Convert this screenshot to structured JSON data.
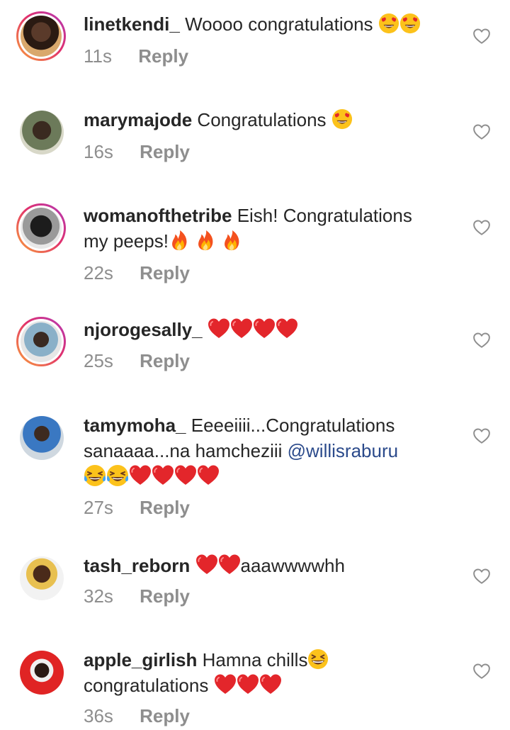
{
  "comments": [
    {
      "username": "linetkendi_",
      "text": "Woooo congratulations",
      "emoji": [
        "heart-eyes",
        "heart-eyes"
      ],
      "time": "11s",
      "reply": "Reply",
      "ring": true
    },
    {
      "username": "marymajode",
      "text": "Congratulations",
      "emoji": [
        "heart-eyes"
      ],
      "time": "16s",
      "reply": "Reply",
      "ring": false
    },
    {
      "username": "womanofthetribe",
      "text": "Eish! Congratulations",
      "text2": "my peeps!",
      "emoji": [
        "fire",
        "fire",
        "fire"
      ],
      "time": "22s",
      "reply": "Reply",
      "ring": true
    },
    {
      "username": "njorogesally_",
      "text": "",
      "emoji": [
        "red-heart",
        "red-heart",
        "red-heart",
        "red-heart"
      ],
      "time": "25s",
      "reply": "Reply",
      "ring": true
    },
    {
      "username": "tamymoha_",
      "text": "Eeeeiiii...Congratulations",
      "text2": "sanaaaa...na hamcheziii",
      "mention": "@willisraburu",
      "emoji": [
        "laughing-tears",
        "laughing-tears",
        "red-heart",
        "red-heart",
        "red-heart",
        "red-heart"
      ],
      "time": "27s",
      "reply": "Reply",
      "ring": false
    },
    {
      "username": "tash_reborn",
      "text_after": "aaawwwwhh",
      "emoji": [
        "red-heart",
        "red-heart"
      ],
      "time": "32s",
      "reply": "Reply",
      "ring": false
    },
    {
      "username": "apple_girlish",
      "text": "Hamna chills",
      "text2": "congratulations",
      "emoji": [
        "grinning-squint"
      ],
      "emoji2": [
        "red-heart",
        "red-heart",
        "red-heart"
      ],
      "time": "36s",
      "reply": "Reply",
      "ring": false
    }
  ],
  "colors": {
    "username": "#262626",
    "meta": "#8e8e8e",
    "mention": "#2b4a8b",
    "heart": "#e3262b",
    "like_outline": "#8e8e8e"
  },
  "icons": {
    "like": "heart-outline-icon",
    "fire": "fire-emoji",
    "heart-eyes": "heart-eyes-emoji",
    "red-heart": "red-heart-emoji",
    "laughing-tears": "face-with-tears-of-joy-emoji",
    "grinning-squint": "grinning-squinting-face-emoji"
  }
}
